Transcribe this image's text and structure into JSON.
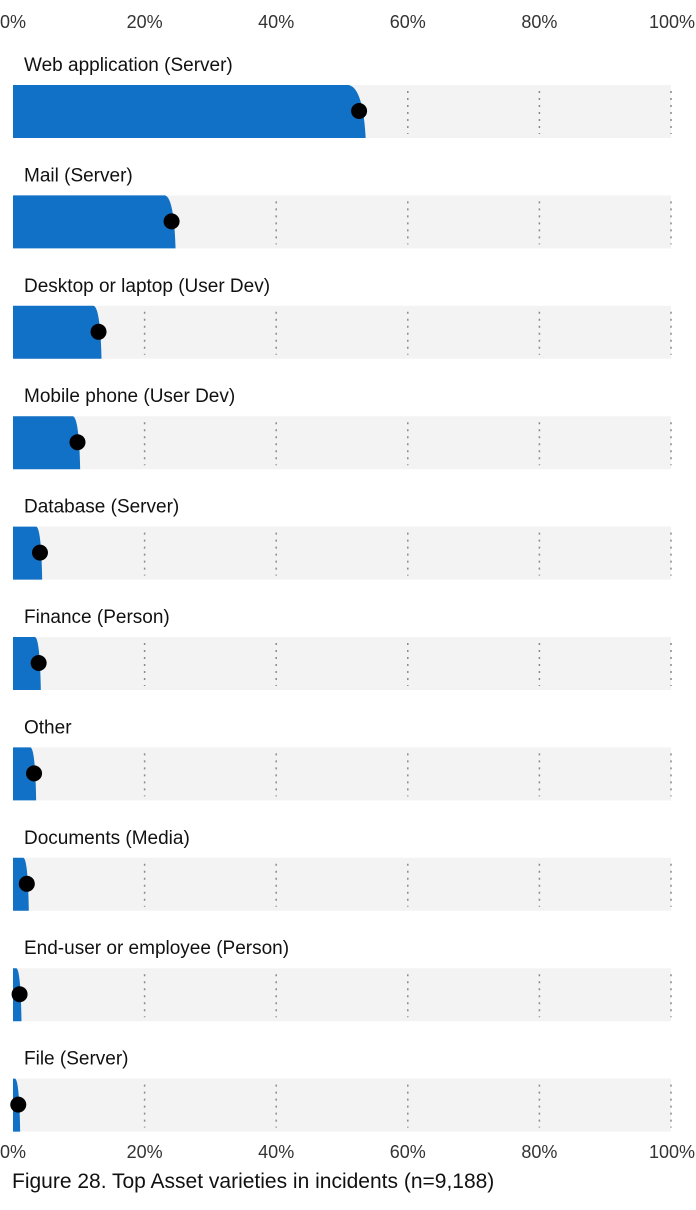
{
  "caption": "Figure 28. Top Asset varieties in incidents (n=9,188)",
  "colors": {
    "bar": "#1171c6",
    "track": "#f3f3f3",
    "dot": "#000000",
    "grid": "#8a8a8a"
  },
  "chart_data": {
    "type": "bar",
    "orientation": "horizontal",
    "xlim": [
      0,
      100
    ],
    "ticks": [
      "0%",
      "20%",
      "40%",
      "60%",
      "80%",
      "100%"
    ],
    "tick_values": [
      0,
      20,
      40,
      60,
      80,
      100
    ],
    "grid": true,
    "categories": [
      "Web application (Server)",
      "Mail (Server)",
      "Desktop or laptop (User Dev)",
      "Mobile phone (User Dev)",
      "Database (Server)",
      "Finance (Person)",
      "Other",
      "Documents (Media)",
      "End-user or employee (Person)",
      "File (Server)"
    ],
    "values": [
      52.6,
      24.1,
      13.0,
      9.8,
      4.1,
      3.9,
      3.2,
      2.1,
      1.0,
      0.8
    ]
  }
}
